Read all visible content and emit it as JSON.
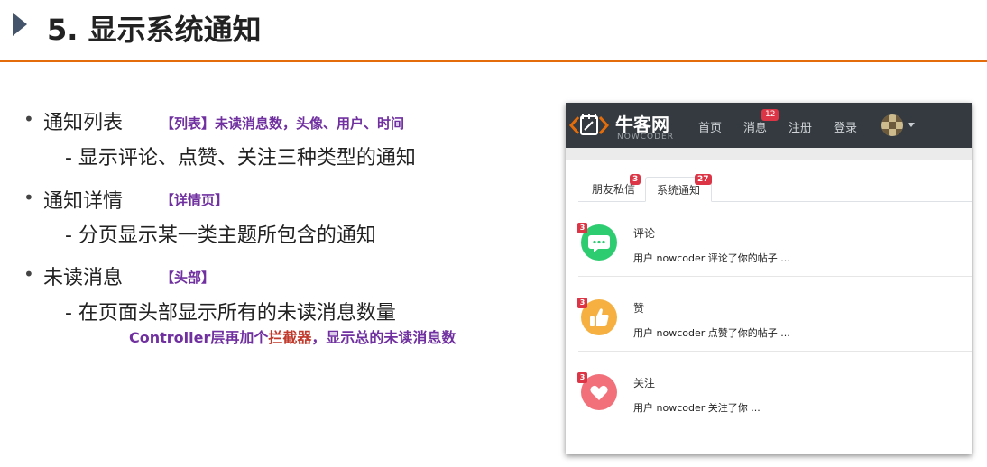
{
  "slide": {
    "title": "5. 显示系统通知"
  },
  "bullets": [
    {
      "text": "通知列表",
      "tag": "【列表】未读消息数，头像、用户、时间",
      "sub": "- 显示评论、点赞、关注三种类型的通知"
    },
    {
      "text": "通知详情",
      "tag": "【详情页】",
      "sub": "- 分页显示某一类主题所包含的通知"
    },
    {
      "text": "未读消息",
      "tag": "【头部】",
      "sub": "- 在页面头部显示所有的未读消息数量"
    }
  ],
  "note": {
    "prefix": "Controller层再加个",
    "highlight": "拦截器",
    "suffix": "，显示总的未读消息数"
  },
  "site": {
    "logo_cn": "牛客网",
    "logo_en": "NOWCODER",
    "nav": [
      {
        "label": "首页"
      },
      {
        "label": "消息",
        "badge": "12"
      },
      {
        "label": "注册"
      },
      {
        "label": "登录"
      }
    ],
    "tabs": [
      {
        "label": "朋友私信",
        "badge": "3",
        "active": false
      },
      {
        "label": "系统通知",
        "badge": "27",
        "active": true
      }
    ],
    "notices": [
      {
        "badge": "3",
        "title": "评论",
        "text": "用户 nowcoder 评论了你的帖子 ...",
        "icon": "comment-icon",
        "color": "#2ecc71"
      },
      {
        "badge": "3",
        "title": "赞",
        "text": "用户 nowcoder 点赞了你的帖子 ...",
        "icon": "thumbs-up-icon",
        "color": "#f5b041"
      },
      {
        "badge": "3",
        "title": "关注",
        "text": "用户 nowcoder 关注了你 ...",
        "icon": "heart-icon",
        "color": "#f1707a"
      }
    ]
  },
  "colors": {
    "accent_rule": "#e46c0a",
    "tag_purple": "#7030a0",
    "highlight_red": "#c0392b",
    "badge_red": "#dc3545",
    "navbar": "#343a40"
  }
}
